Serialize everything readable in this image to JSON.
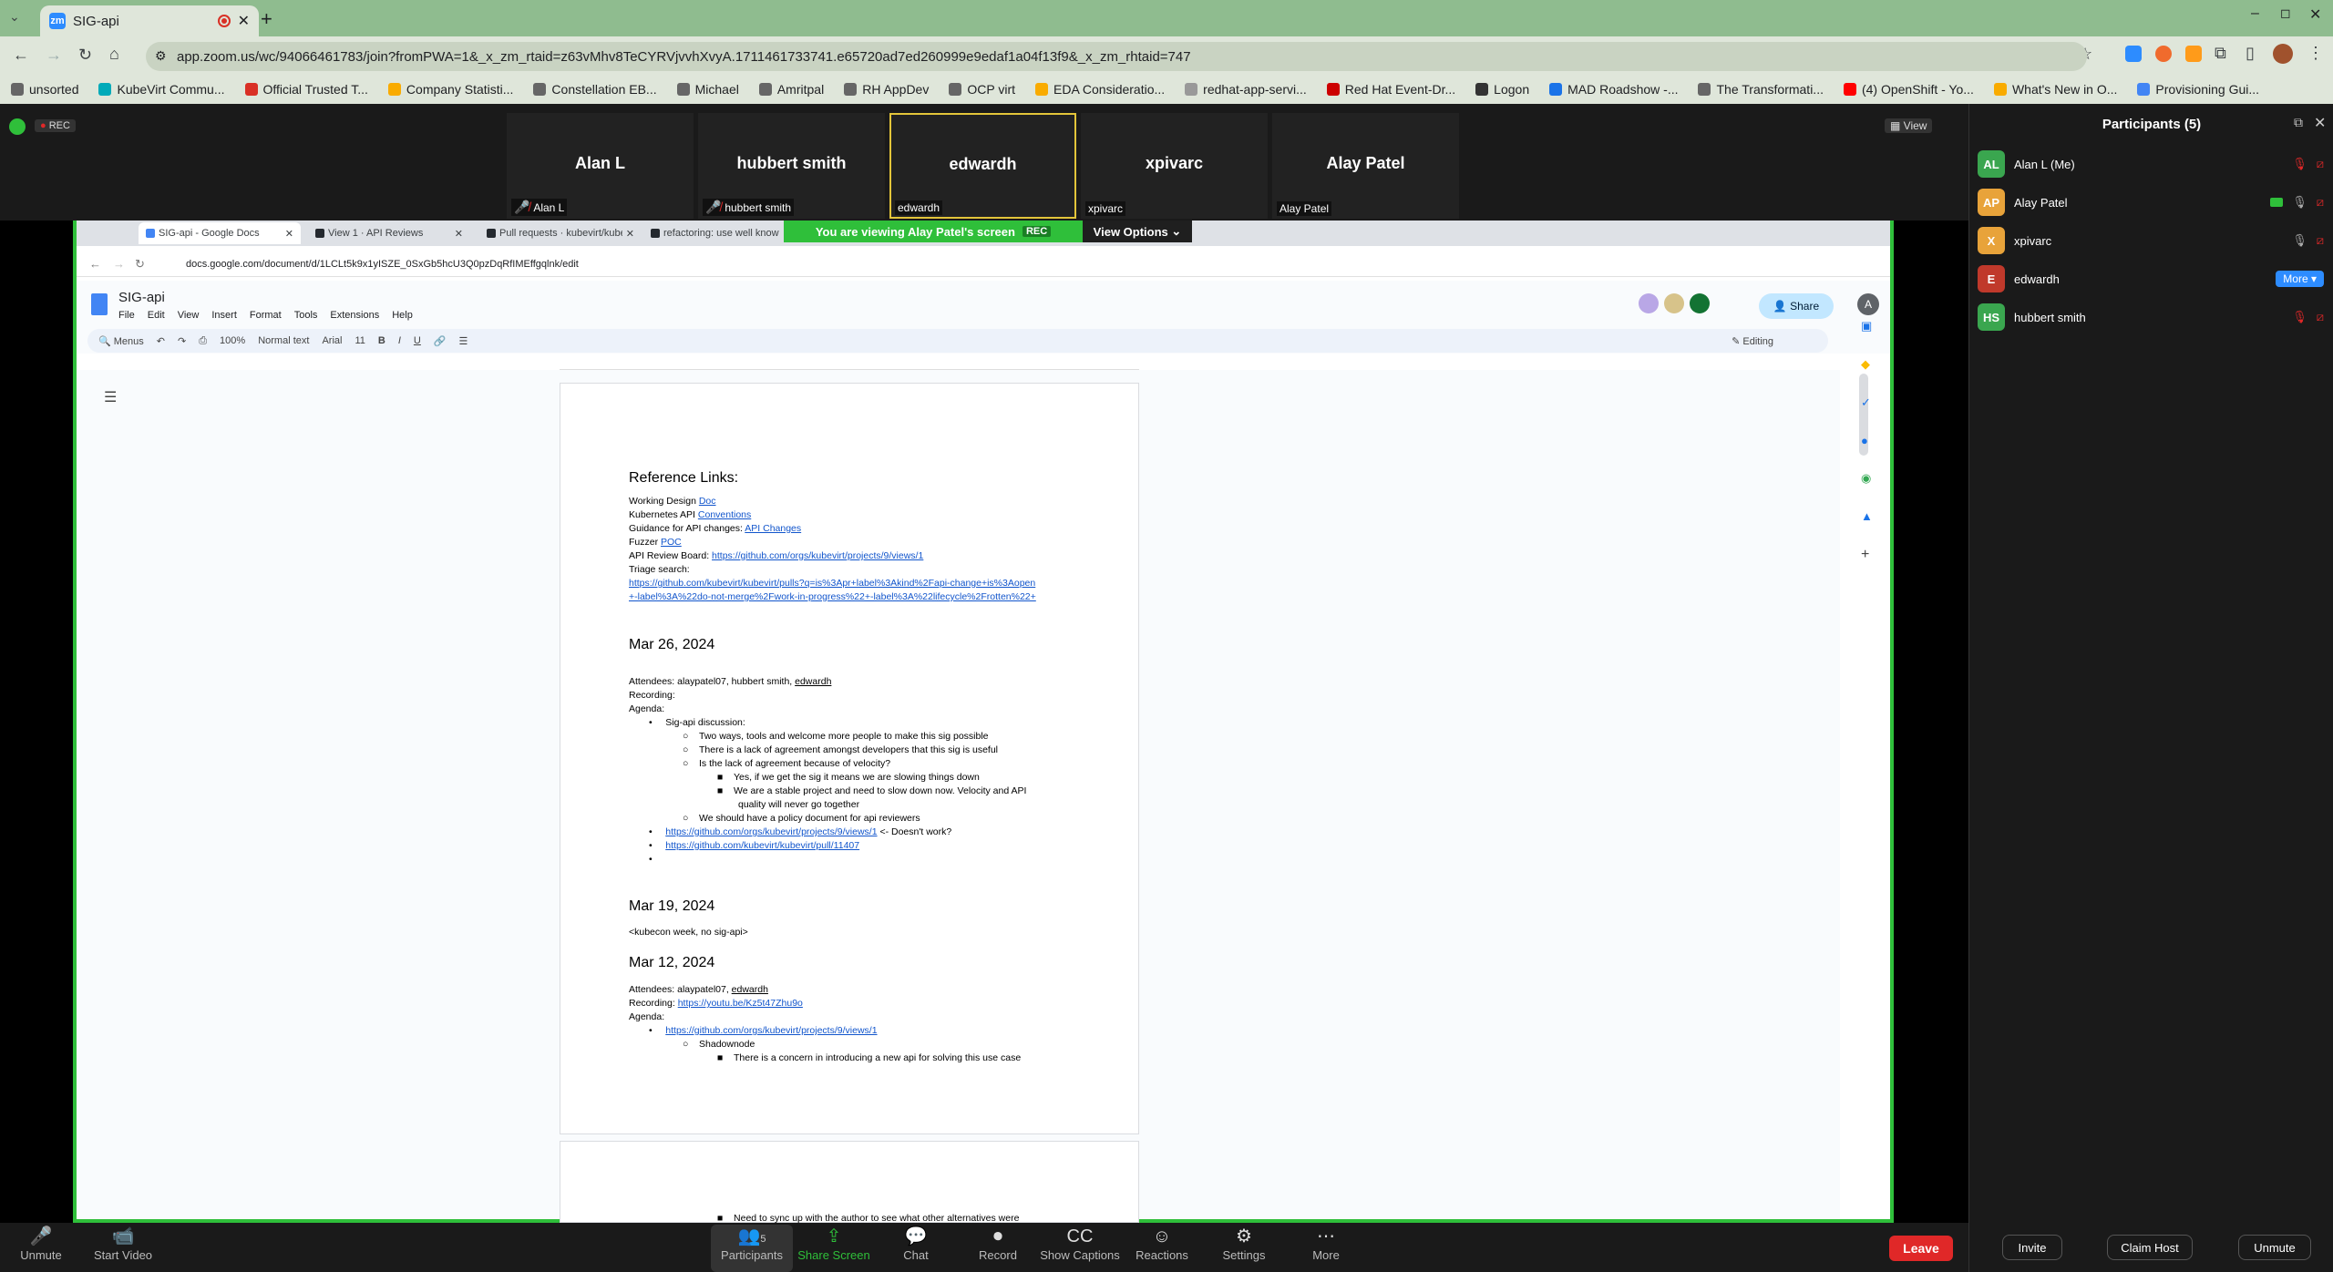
{
  "browser": {
    "tab_title": "SIG-api",
    "url": "app.zoom.us/wc/94066461783/join?fromPWA=1&_x_zm_rtaid=z63vMhv8TeCYRVjvvhXvyA.1711461733741.e65720ad7ed260999e9edaf1a04f13f9&_x_zm_rhtaid=747",
    "bookmarks": [
      "unsorted",
      "KubeVirt Commu...",
      "Official Trusted T...",
      "Company Statisti...",
      "Constellation EB...",
      "Michael",
      "Amritpal",
      "RH AppDev",
      "OCP virt",
      "EDA Consideratio...",
      "redhat-app-servi...",
      "Red Hat Event-Dr...",
      "Logon",
      "MAD Roadshow -...",
      "The Transformati...",
      "(4) OpenShift - Yo...",
      "What's New in O...",
      "Provisioning Gui..."
    ]
  },
  "zoom": {
    "rec_label": "REC",
    "view_label": "View",
    "tiles": [
      {
        "name": "Alan L",
        "label": "Alan L"
      },
      {
        "name": "hubbert smith",
        "label": "hubbert smith"
      },
      {
        "name": "edwardh",
        "label": "edwardh"
      },
      {
        "name": "xpivarc",
        "label": "xpivarc"
      },
      {
        "name": "Alay Patel",
        "label": "Alay Patel"
      }
    ],
    "banner": "You are viewing  Alay Patel's screen",
    "banner_rec": "REC",
    "view_options": "View Options",
    "bottom": [
      {
        "label": "Unmute"
      },
      {
        "label": "Start Video"
      },
      {
        "label": "Participants",
        "count": "5"
      },
      {
        "label": "Share Screen"
      },
      {
        "label": "Chat"
      },
      {
        "label": "Record"
      },
      {
        "label": "Show Captions"
      },
      {
        "label": "Reactions"
      },
      {
        "label": "Settings"
      },
      {
        "label": "More"
      }
    ],
    "leave": "Leave"
  },
  "panel": {
    "title": "Participants (5)",
    "participants": [
      {
        "initials": "AL",
        "name": "Alan L (Me)",
        "color": "#3aa64f"
      },
      {
        "initials": "AP",
        "name": "Alay Patel",
        "color": "#e8a33a"
      },
      {
        "initials": "X",
        "name": "xpivarc",
        "color": "#e8a33a"
      },
      {
        "initials": "E",
        "name": "edwardh",
        "color": "#c0392b"
      },
      {
        "initials": "HS",
        "name": "hubbert smith",
        "color": "#3aa64f"
      }
    ],
    "more_label": "More",
    "buttons": {
      "invite": "Invite",
      "claim": "Claim Host",
      "unmute": "Unmute"
    }
  },
  "shared": {
    "tabs": [
      "SIG-api - Google Docs",
      "View 1 · API Reviews",
      "Pull requests · kubevirt/kube",
      "refactoring: use well know"
    ],
    "url": "docs.google.com/document/d/1LCLt5k9x1yISZE_0SxGb5hcU3Q0pzDqRfIMEffgqlnk/edit",
    "doc_title": "SIG-api",
    "menu": [
      "File",
      "Edit",
      "View",
      "Insert",
      "Format",
      "Tools",
      "Extensions",
      "Help"
    ],
    "share": "Share",
    "toolbar": {
      "menus": "Menus",
      "zoom": "100%",
      "style": "Normal text",
      "font": "Arial",
      "size": "11",
      "editing": "Editing"
    },
    "doc": {
      "ref_heading": "Reference Links:",
      "ref": [
        {
          "pre": "Working Design ",
          "link": "Doc"
        },
        {
          "pre": "Kubernetes API ",
          "link": "Conventions"
        },
        {
          "pre": "Guidance for API changes: ",
          "link": "API Changes"
        },
        {
          "pre": "Fuzzer ",
          "link": "POC"
        },
        {
          "pre": "API Review Board: ",
          "link": "https://github.com/orgs/kubevirt/projects/9/views/1"
        },
        {
          "pre": "Triage search:",
          "link": ""
        }
      ],
      "triage1": "https://github.com/kubevirt/kubevirt/pulls?q=is%3Apr+label%3Akind%2Fapi-change+is%3Aopen",
      "triage2": "+-label%3A%22do-not-merge%2Fwork-in-progress%22+-label%3A%22lifecycle%2Frotten%22+",
      "d1": "Mar 26, 2024",
      "d1_att_pre": "Attendees: alaypatel07, hubbert smith, ",
      "d1_att_link": "edwardh",
      "recording": "Recording:",
      "agenda": "Agenda:",
      "b1": "Sig-api discussion:",
      "b1a": "Two ways, tools and welcome more people to make this sig possible",
      "b1b": "There is a lack of agreement amongst developers that this sig is useful",
      "b1c": "Is the lack of agreement because of velocity?",
      "b1c1": "Yes, if we get the sig it means we are slowing things down",
      "b1c2": "We are a stable project and need to slow down now. Velocity and API",
      "b1c2b": "quality will never go together",
      "b1d": "We should have a policy document for api reviewers",
      "b2": "https://github.com/orgs/kubevirt/projects/9/views/1",
      "b2s": " <- Doesn't work?",
      "b3": "https://github.com/kubevirt/kubevirt/pull/11407",
      "d2": "Mar 19, 2024",
      "d2_note": "<kubecon week, no sig-api>",
      "d3": "Mar 12, 2024",
      "d3_att_pre": "Attendees:  alaypatel07, ",
      "d3_att_link": "edwardh",
      "d3_rec_pre": "Recording: ",
      "d3_rec_link": "https://youtu.be/Kz5t47Zhu9o",
      "d3_b1": "https://github.com/orgs/kubevirt/projects/9/views/1",
      "d3_b1a": "Shadownode",
      "d3_b1a1": "There is a concern in introducing a new api for solving this use case",
      "p2": "Need to sync up with the author to see what other alternatives were"
    }
  }
}
